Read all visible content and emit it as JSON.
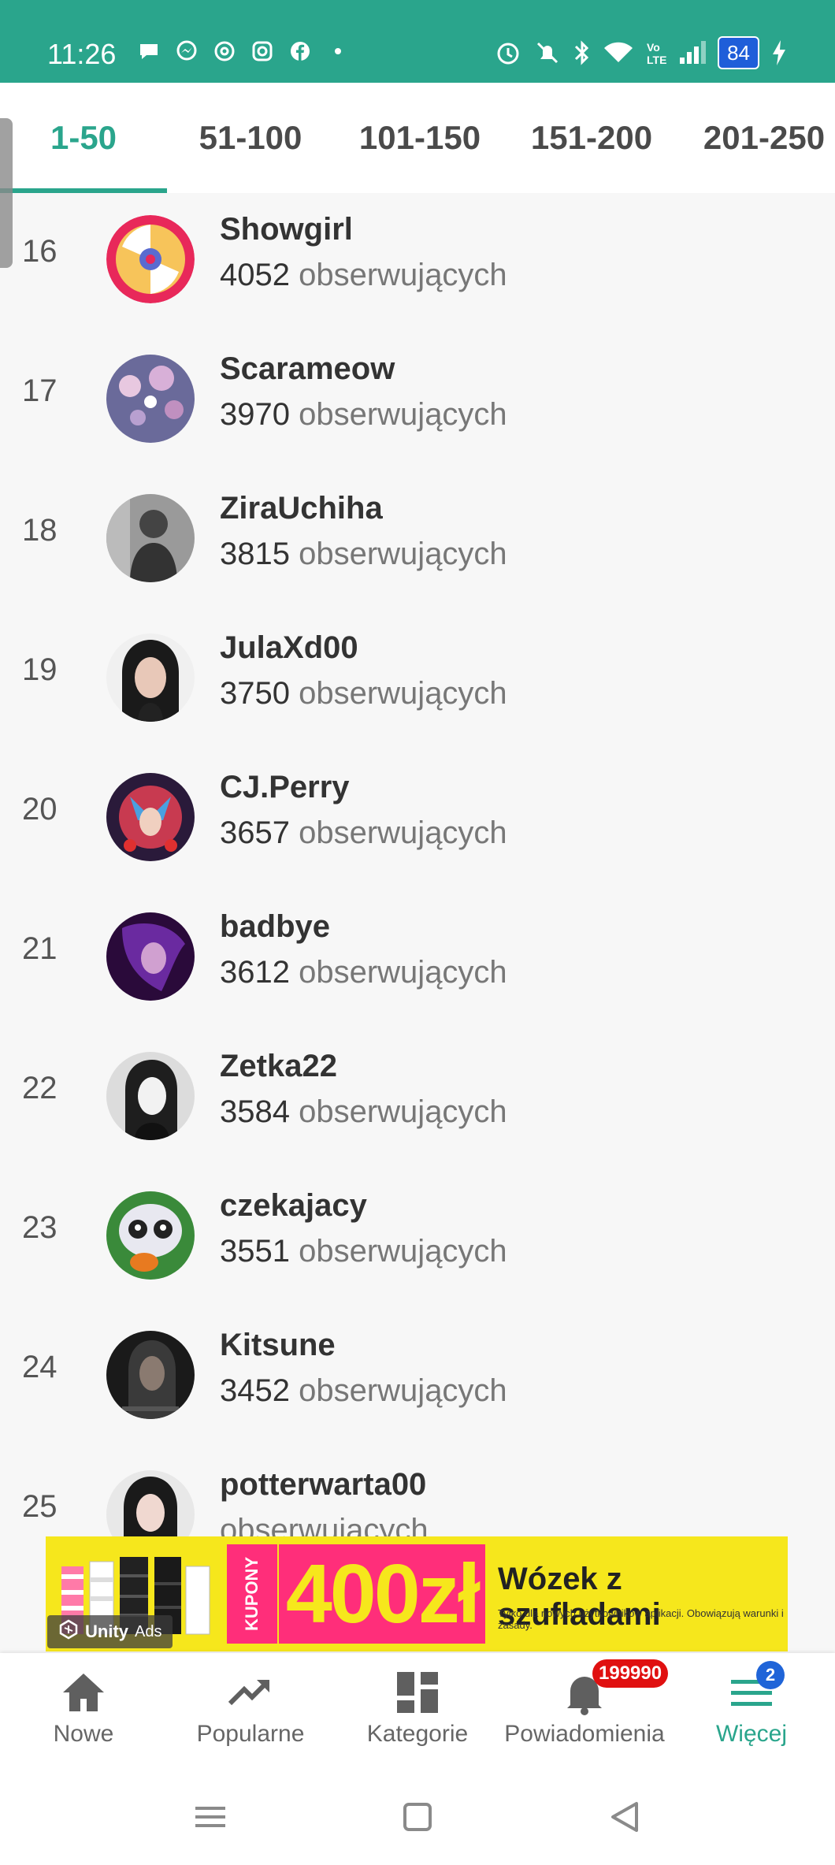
{
  "status_bar": {
    "time": "11:26",
    "battery": "84",
    "left_icons": [
      "chat-bubble-icon",
      "messenger-icon",
      "at-sign-icon",
      "instagram-icon",
      "facebook-icon",
      "dot-icon"
    ],
    "right_icons": [
      "alarm-icon",
      "mute-icon",
      "bluetooth-icon",
      "wifi-icon",
      "volte-icon",
      "signal-icon",
      "battery-icon",
      "charging-icon"
    ]
  },
  "tabs": [
    {
      "label": "1-50",
      "active": true
    },
    {
      "label": "51-100"
    },
    {
      "label": "101-150"
    },
    {
      "label": "151-200"
    },
    {
      "label": "201-250"
    }
  ],
  "ranking": {
    "followers_suffix": "obserwujących",
    "rows": [
      {
        "rank": "16",
        "username": "Showgirl",
        "followers": "4052"
      },
      {
        "rank": "17",
        "username": "Scarameow",
        "followers": "3970"
      },
      {
        "rank": "18",
        "username": "ZiraUchiha",
        "followers": "3815"
      },
      {
        "rank": "19",
        "username": "JulaXd00",
        "followers": "3750"
      },
      {
        "rank": "20",
        "username": "CJ.Perry",
        "followers": "3657"
      },
      {
        "rank": "21",
        "username": "badbye",
        "followers": "3612"
      },
      {
        "rank": "22",
        "username": "Zetka22",
        "followers": "3584"
      },
      {
        "rank": "23",
        "username": "czekajacy",
        "followers": "3551"
      },
      {
        "rank": "24",
        "username": "Kitsune",
        "followers": "3452"
      },
      {
        "rank": "25",
        "username": "potterwarta00",
        "followers": ""
      }
    ]
  },
  "ad": {
    "coupon_label": "KUPONY",
    "amount": "400zł",
    "title": "Wózek z szufladami",
    "subtitle": "Tylko dla nowych użytkowników aplikacji. Obowiązują warunki i zasady.",
    "unity_label": "Unity",
    "ads_label": "Ads",
    "background": "#f6e71c",
    "accent": "#ff2e7a"
  },
  "bottom_nav": {
    "items": [
      {
        "label": "Nowe",
        "icon": "home-icon"
      },
      {
        "label": "Popularne",
        "icon": "trending-icon"
      },
      {
        "label": "Kategorie",
        "icon": "grid-icon"
      },
      {
        "label": "Powiadomienia",
        "icon": "bell-icon"
      },
      {
        "label": "Więcej",
        "icon": "menu-icon",
        "active": true
      }
    ],
    "notifications_badge": "199990",
    "more_badge": "2"
  },
  "colors": {
    "accent": "#2aa58c",
    "badge_red": "#e01010",
    "badge_blue": "#1f64d8"
  }
}
